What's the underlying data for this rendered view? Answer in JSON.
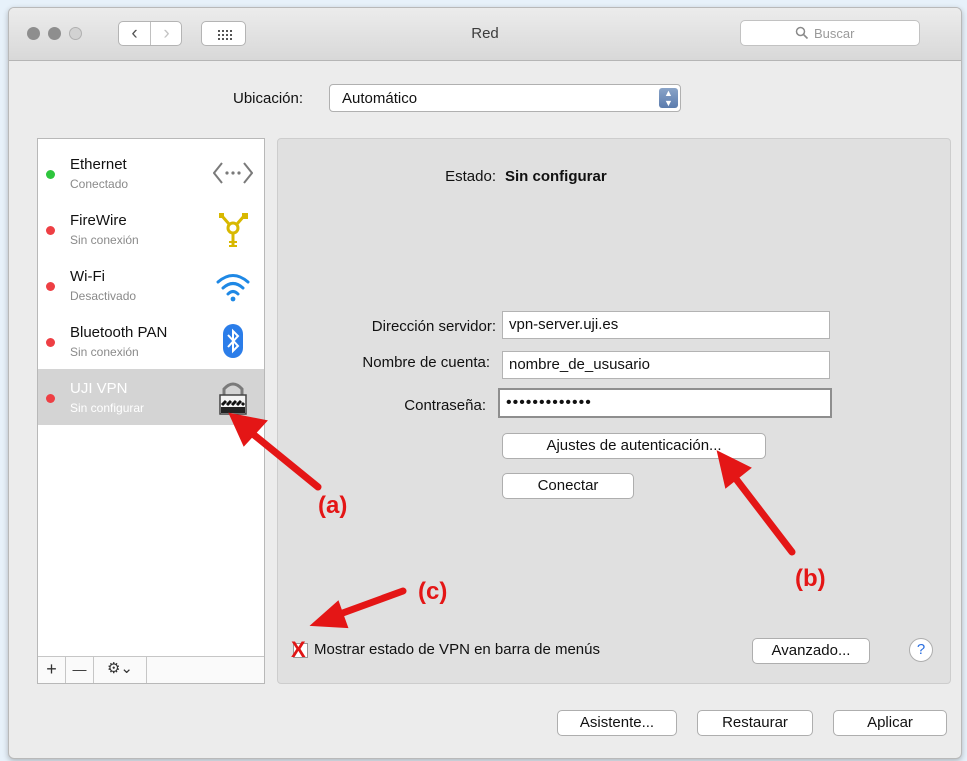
{
  "window": {
    "title": "Red",
    "search_placeholder": "Buscar"
  },
  "location": {
    "label": "Ubicación:",
    "value": "Automático"
  },
  "services": [
    {
      "name": "Ethernet",
      "status": "Conectado",
      "status_color": "#2ec53d",
      "icon": "ethernet-icon"
    },
    {
      "name": "FireWire",
      "status": "Sin conexión",
      "status_color": "#ee3f44",
      "icon": "firewire-icon"
    },
    {
      "name": "Wi-Fi",
      "status": "Desactivado",
      "status_color": "#ee3f44",
      "icon": "wifi-icon"
    },
    {
      "name": "Bluetooth PAN",
      "status": "Sin conexión",
      "status_color": "#ee3f44",
      "icon": "bluetooth-icon"
    },
    {
      "name": "UJI VPN",
      "status": "Sin configurar",
      "status_color": "#ee3f44",
      "icon": "vpn-lock-icon",
      "selected": true
    }
  ],
  "sidebar_controls": {
    "add": "+",
    "remove": "—",
    "gear": "⚙︎⌄"
  },
  "detail": {
    "state_label": "Estado:",
    "state_value": "Sin configurar",
    "server_label": "Dirección servidor:",
    "server_value": "vpn-server.uji.es",
    "account_label": "Nombre de cuenta:",
    "account_value": "nombre_de_ususario",
    "password_label": "Contraseña:",
    "password_value": "•••••••••••••",
    "auth_button": "Ajustes de autenticación...",
    "connect_button": "Conectar",
    "show_vpn_label": "Mostrar estado de VPN en barra de menús",
    "show_vpn_checked_mark": "X",
    "advanced_button": "Avanzado...",
    "help": "?"
  },
  "footer": {
    "assistant_button": "Asistente...",
    "restore_button": "Restaurar",
    "apply_button": "Aplicar"
  },
  "annotations": {
    "a": "(a)",
    "b": "(b)",
    "c": "(c)",
    "color": "#e41616"
  }
}
